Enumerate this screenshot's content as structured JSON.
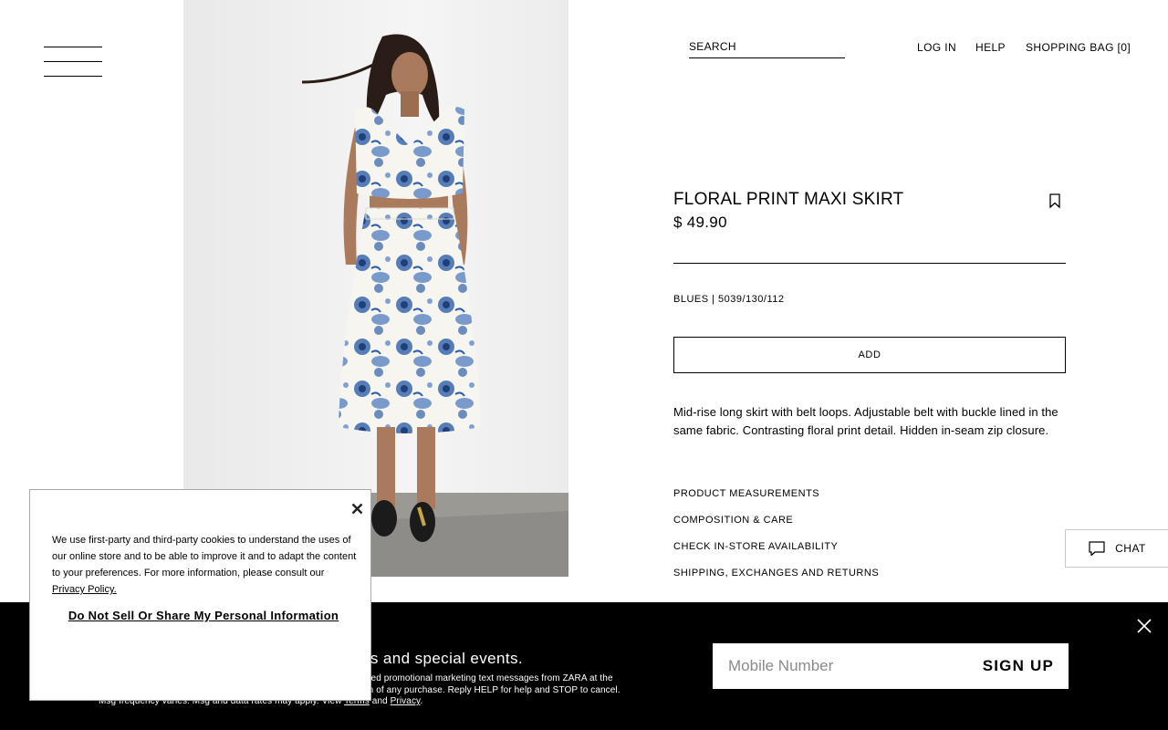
{
  "header": {
    "search_label": "SEARCH",
    "login_label": "LOG IN",
    "help_label": "HELP",
    "bag_label": "SHOPPING BAG [0]"
  },
  "product": {
    "title": "FLORAL PRINT MAXI SKIRT",
    "price": "$ 49.90",
    "color_ref": "BLUES | 5039/130/112",
    "add_label": "ADD",
    "description": "Mid-rise long skirt with belt loops. Adjustable belt with buckle lined in the same fabric. Contrasting floral print detail. Hidden in-seam zip closure.",
    "links": [
      "PRODUCT MEASUREMENTS",
      "COMPOSITION & CARE",
      "CHECK IN-STORE AVAILABILITY",
      "SHIPPING, EXCHANGES AND RETURNS"
    ]
  },
  "chat": {
    "label": "CHAT"
  },
  "sms_banner": {
    "heading_visible": "ds and special events.",
    "legal_line1": "ated promotional marketing text messages from ZARA at the",
    "legal_line2": "on of any purchase. Reply HELP for help and STOP to cancel.",
    "legal_line3_prefix": "Msg frequency varies. Msg and data rates may apply. View ",
    "terms_label": "Terms",
    "and_label": " and ",
    "privacy_label": "Privacy",
    "period": ".",
    "input_placeholder": "Mobile Number",
    "signup_label": "SIGN UP"
  },
  "cookie_dialog": {
    "text": "We use first-party and third-party cookies to understand the uses of our online store and to be able to improve it and to adapt the content to your preferences. For more information, please consult our ",
    "privacy_link": "Privacy Policy.",
    "do_not_sell_label": "Do Not Sell Or Share My Personal Information"
  },
  "colors": {
    "text": "#000000",
    "banner_bg": "#000000",
    "print_blue": "#2f5fa8"
  },
  "icons": {
    "menu": "hamburger-icon",
    "bookmark": "bookmark-icon",
    "chat": "chat-bubble-icon",
    "close": "close-icon"
  }
}
